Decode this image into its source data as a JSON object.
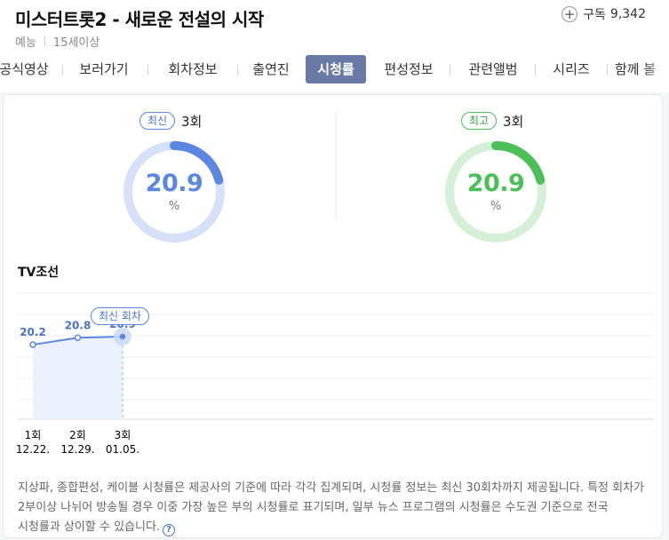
{
  "program": {
    "title": "미스터트롯2 - 새로운 전설의 시작",
    "genre": "예능",
    "rating": "15세이상",
    "subscribe_label": "구독",
    "subscribe_count": "9,342"
  },
  "tabs": [
    {
      "label": "공식영상"
    },
    {
      "label": "보러가기"
    },
    {
      "label": "회차정보"
    },
    {
      "label": "출연진"
    },
    {
      "label": "시청률",
      "active": true
    },
    {
      "label": "편성정보"
    },
    {
      "label": "관련앨범"
    },
    {
      "label": "시리즈"
    },
    {
      "label": "함께 볼"
    }
  ],
  "latest": {
    "badge": "최신",
    "episode": "3회",
    "value": "20.9",
    "unit": "%",
    "fraction": 0.209,
    "color": "#5b87e0",
    "track": "#d6e1f9"
  },
  "best": {
    "badge": "최고",
    "episode": "3회",
    "value": "20.9",
    "unit": "%",
    "fraction": 0.209,
    "color": "#4cbf58",
    "track": "#d4f0d6"
  },
  "channel": "TV조선",
  "latest_marker_label": "최신 회차",
  "chart_data": {
    "type": "line",
    "categories": [
      "1회",
      "2회",
      "3회"
    ],
    "dates": [
      "12.22.",
      "12.29.",
      "01.05."
    ],
    "values": [
      20.2,
      20.8,
      20.9
    ],
    "ylim": [
      0,
      100
    ]
  },
  "notice": "지상파, 종합편성, 케이블 시청률은 제공사의 기준에 따라 각각 집계되며, 시청률 정보는 최신 30회차까지 제공됩니다. 특정 회차가 2부이상 나뉘어 방송될 경우 이중 가장 높은 부의 시청률로 표기되며, 일부 뉴스 프로그램의 시청률은 수도권 기준으로 전국 시청률과 상이할 수 있습니다.",
  "help_icon": "question-circle-icon"
}
